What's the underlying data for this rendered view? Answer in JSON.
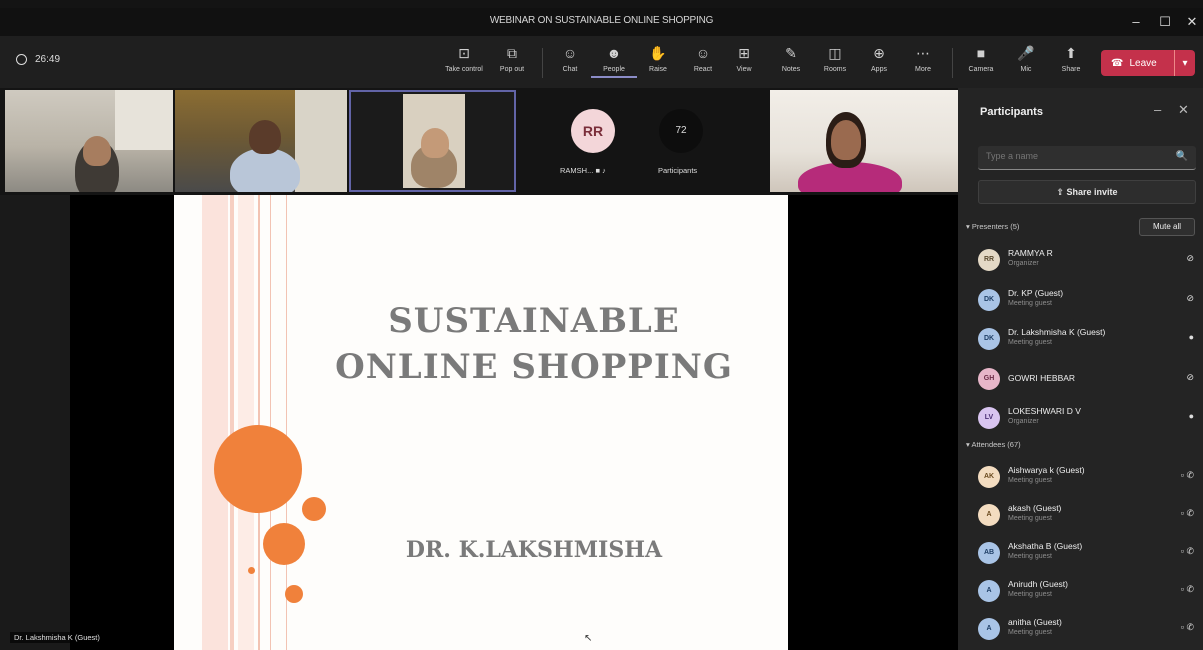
{
  "window": {
    "title": "WEBINAR ON SUSTAINABLE ONLINE SHOPPING",
    "minimize": "–",
    "maximize": "☐",
    "close": "✕"
  },
  "toolbar": {
    "timer": "26:49",
    "buttons": [
      {
        "label": "Take control",
        "icon": "share-tray-icon",
        "glyph": "⊡"
      },
      {
        "label": "Pop out",
        "icon": "pop-out-icon",
        "glyph": "⧉"
      },
      {
        "label": "Chat",
        "icon": "chat-icon",
        "glyph": "☺"
      },
      {
        "label": "People",
        "icon": "people-icon",
        "glyph": "☻"
      },
      {
        "label": "Raise",
        "icon": "raise-hand-icon",
        "glyph": "✋"
      },
      {
        "label": "React",
        "icon": "react-icon",
        "glyph": "☺"
      },
      {
        "label": "View",
        "icon": "view-grid-icon",
        "glyph": "⊞"
      },
      {
        "label": "Notes",
        "icon": "notes-icon",
        "glyph": "✎"
      },
      {
        "label": "Rooms",
        "icon": "rooms-icon",
        "glyph": "◫"
      },
      {
        "label": "Apps",
        "icon": "apps-icon",
        "glyph": "⊕"
      },
      {
        "label": "More",
        "icon": "more-icon",
        "glyph": "⋯"
      },
      {
        "label": "Camera",
        "icon": "camera-icon",
        "glyph": "■"
      },
      {
        "label": "Mic",
        "icon": "mic-off-icon",
        "glyph": "🎤"
      },
      {
        "label": "Share",
        "icon": "share-icon",
        "glyph": "⬆"
      }
    ],
    "leave_label": "Leave"
  },
  "stage": {
    "avatar_rr": {
      "initials": "RR",
      "label": "RAMSH..."
    },
    "avatar_participants": {
      "count": "72",
      "label": "Participants"
    },
    "slide_title_line1": "SUSTAINABLE",
    "slide_title_line2": "ONLINE SHOPPING",
    "slide_author": "DR. K.LAKSHMISHA",
    "speaker_name": "Dr. Lakshmisha K (Guest)"
  },
  "panel": {
    "title": "Participants",
    "search_placeholder": "Type a name",
    "share_invite": "Share invite",
    "presenters_header": "Presenters (5)",
    "mute_all": "Mute all",
    "presenters": [
      {
        "initials": "RR",
        "name": "RAMMYA R",
        "role": "Organizer",
        "avatar_color": "#e4d9c6",
        "text_color": "#5a4a2f",
        "status": "mic-off-icon"
      },
      {
        "initials": "DK",
        "name": "Dr. KP (Guest)",
        "role": "Meeting guest",
        "avatar_color": "#a9c4e6",
        "text_color": "#1f3f66",
        "status": "mic-off-icon"
      },
      {
        "initials": "DK",
        "name": "Dr. Lakshmisha K (Guest)",
        "role": "Meeting guest",
        "avatar_color": "#a9c4e6",
        "text_color": "#1f3f66",
        "status": "mic-on-icon"
      },
      {
        "initials": "GH",
        "name": "GOWRI HEBBAR",
        "role": "",
        "avatar_color": "#e7b6c9",
        "text_color": "#6a2a45",
        "status": "mic-off-icon"
      },
      {
        "initials": "LV",
        "name": "LOKESHWARI D V",
        "role": "Organizer",
        "avatar_color": "#d8c4f0",
        "text_color": "#4b2f75",
        "status": "mic-on-icon"
      }
    ],
    "attendees_header": "Attendees (67)",
    "attendees": [
      {
        "initials": "AK",
        "name": "Aishwarya k (Guest)",
        "role": "Meeting guest",
        "avatar_color": "#f3dcc0",
        "text_color": "#6a4a1f"
      },
      {
        "initials": "A",
        "name": "akash (Guest)",
        "role": "Meeting guest",
        "avatar_color": "#f3dcc0",
        "text_color": "#6a4a1f"
      },
      {
        "initials": "AB",
        "name": "Akshatha B (Guest)",
        "role": "Meeting guest",
        "avatar_color": "#a9c4e6",
        "text_color": "#1f3f66"
      },
      {
        "initials": "A",
        "name": "Anirudh (Guest)",
        "role": "Meeting guest",
        "avatar_color": "#a9c4e6",
        "text_color": "#1f3f66"
      },
      {
        "initials": "A",
        "name": "anitha (Guest)",
        "role": "Meeting guest",
        "avatar_color": "#a9c4e6",
        "text_color": "#1f3f66"
      }
    ]
  },
  "colors": {
    "accent": "#6264a7",
    "leave": "#c4314b",
    "slide_orange": "#f0813b"
  }
}
